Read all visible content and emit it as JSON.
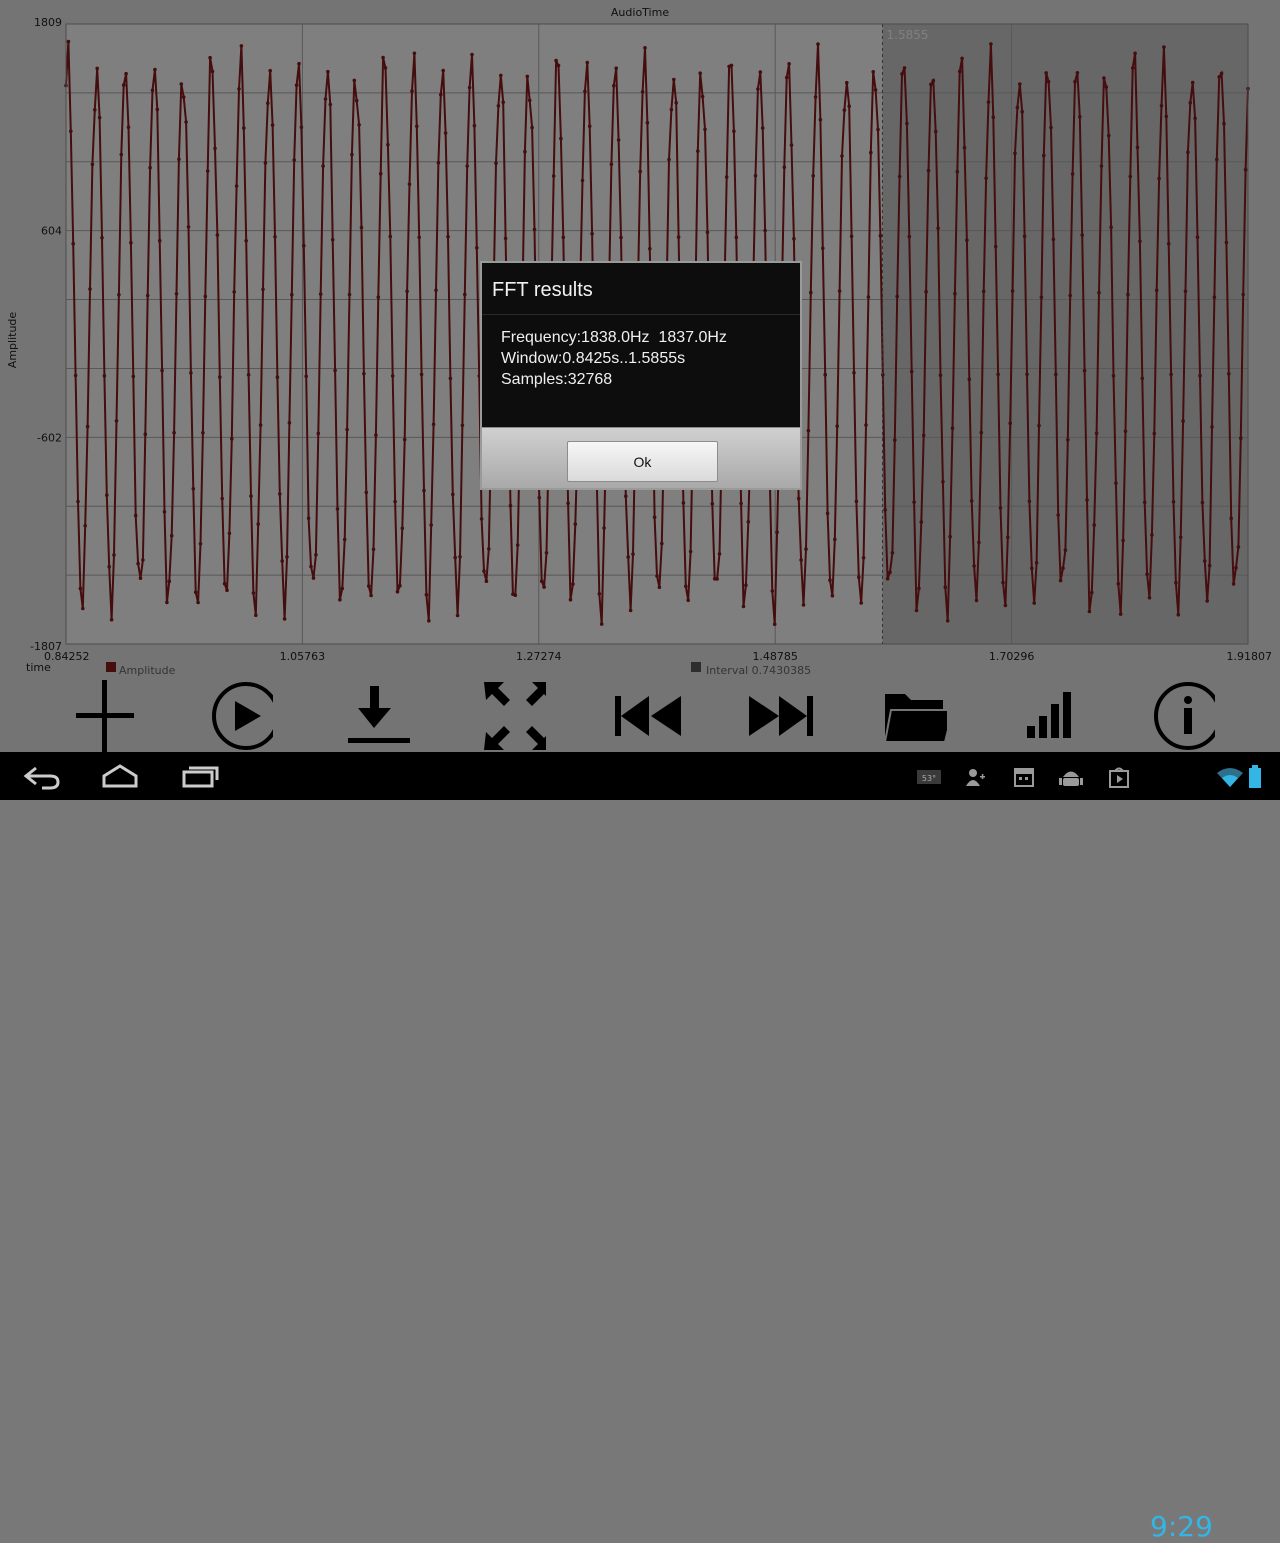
{
  "chart_data": {
    "type": "line",
    "title": "AudioTime",
    "xlabel": "time",
    "ylabel": "Amplitude",
    "ylim": [
      -1807,
      1809
    ],
    "xlim": [
      0.84252,
      1.91807
    ],
    "y_ticks": [
      "1809",
      "604",
      "-602",
      "-1807"
    ],
    "x_ticks": [
      "0.84252",
      "1.05763",
      "1.27274",
      "1.48785",
      "1.70296",
      "1.91807"
    ],
    "cursor_x": 1.5855,
    "cursor_label": "1.5855",
    "selection_window": [
      0.8425,
      1.5855
    ],
    "series": [
      {
        "name": "Amplitude",
        "color": "#8b1a1a",
        "cycles_visible": 41
      }
    ],
    "legend": {
      "series_label": "Amplitude",
      "interval_label": "Interval 0.7430385"
    }
  },
  "toolbar": {
    "buttons": [
      {
        "icon": "plus-icon",
        "name": "add-marker-button"
      },
      {
        "icon": "play-icon",
        "name": "play-button"
      },
      {
        "icon": "download-icon",
        "name": "download-button"
      },
      {
        "icon": "expand-icon",
        "name": "fit-view-button"
      },
      {
        "icon": "rewind-icon",
        "name": "rewind-button"
      },
      {
        "icon": "fast-forward-icon",
        "name": "fast-forward-button"
      },
      {
        "icon": "folder-icon",
        "name": "open-file-button"
      },
      {
        "icon": "signal-bars-icon",
        "name": "spectrum-button"
      },
      {
        "icon": "info-icon",
        "name": "info-button"
      }
    ]
  },
  "dialog": {
    "title": "FFT results",
    "lines": [
      "Frequency:1838.0Hz  1837.0Hz",
      "Window:0.8425s..1.5855s",
      "Samples:32768"
    ],
    "ok_label": "Ok"
  },
  "statusbar": {
    "time": "9:29",
    "temperature": "53°",
    "icons": [
      "weather-icon",
      "add-contact-icon",
      "calendar-icon",
      "android-icon",
      "play-store-icon",
      "wifi-icon",
      "battery-icon"
    ]
  },
  "navbar": {
    "icons": [
      "back-icon",
      "home-icon",
      "recent-apps-icon"
    ]
  },
  "colors": {
    "trace": "#8b1a1a",
    "plot_bg": "#cfcfcf",
    "selected_bg": "#ffffff",
    "accent": "#33b5e5"
  }
}
